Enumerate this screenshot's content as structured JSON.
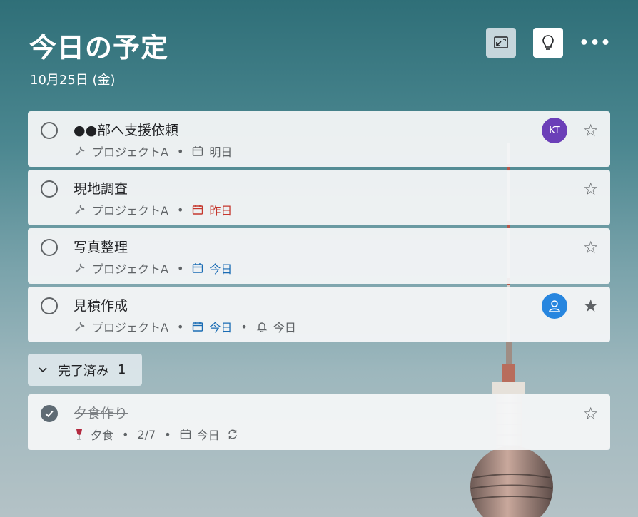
{
  "header": {
    "title": "今日の予定",
    "date": "10月25日 (金)",
    "more_label": "•••"
  },
  "tasks": [
    {
      "title": "●●部へ支援依頼",
      "list": "プロジェクトA",
      "due": "明日",
      "due_style": "normal",
      "avatar": "KT",
      "starred": false
    },
    {
      "title": "現地調査",
      "list": "プロジェクトA",
      "due": "昨日",
      "due_style": "overdue",
      "starred": false
    },
    {
      "title": "写真整理",
      "list": "プロジェクトA",
      "due": "今日",
      "due_style": "today",
      "starred": false
    },
    {
      "title": "見積作成",
      "list": "プロジェクトA",
      "due": "今日",
      "due_style": "today",
      "reminder": "今日",
      "avatar": "person",
      "starred": true
    }
  ],
  "completed_section": {
    "label": "完了済み",
    "count": "1"
  },
  "completed_tasks": [
    {
      "title": "夕食作り",
      "list": "夕食",
      "steps": "2/7",
      "due": "今日",
      "repeat": true,
      "starred": false
    }
  ],
  "colors": {
    "overdue": "#c5382e",
    "today": "#1a6cb4",
    "avatar_kt": "#6b3fb8",
    "avatar_person": "#2786df"
  },
  "icons": {
    "list": "wrench-icon",
    "due": "calendar-icon",
    "reminder": "bell-icon",
    "repeat": "repeat-icon",
    "completed_list": "wine-glass-icon"
  }
}
